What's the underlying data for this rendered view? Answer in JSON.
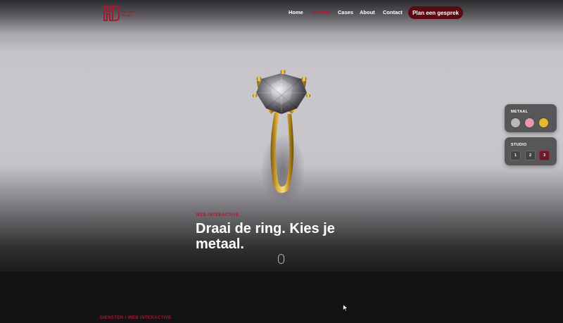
{
  "header": {
    "logo_text_line1": "Horsman's",
    "logo_text_line2": "Design",
    "nav": [
      {
        "label": "Home",
        "active": false
      },
      {
        "label": "Service",
        "active": true
      },
      {
        "label": "Cases",
        "active": false
      },
      {
        "label": "About",
        "active": false
      },
      {
        "label": "Contact",
        "active": false
      }
    ],
    "cta_label": "Plan een gesprek"
  },
  "configurator": {
    "metal": {
      "title": "METAAL",
      "options": [
        {
          "name": "silver",
          "color": "#b9b8bb"
        },
        {
          "name": "rose-gold",
          "color": "#e899a8"
        },
        {
          "name": "gold",
          "color": "#e2bb33"
        }
      ]
    },
    "studio": {
      "title": "STUDIO",
      "options": [
        "1",
        "2",
        "3"
      ],
      "selected": "3"
    }
  },
  "hero": {
    "eyebrow": "WEB INTERACTIVE",
    "headline": "Draai de ring. Kies je metaal."
  },
  "section": {
    "label": "DIENSTEN / WEB INTERACTIVE"
  },
  "colors": {
    "accent": "#a8192f",
    "cta_bg": "#5b0912",
    "gold": "#d8a82b"
  }
}
